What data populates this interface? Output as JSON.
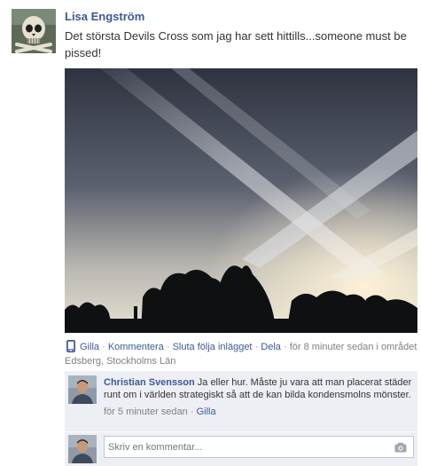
{
  "post": {
    "author": "Lisa Engström",
    "message": "Det största Devils Cross som jag har sett hittills...someone must be pissed!",
    "photo_alt": "Devils Cross"
  },
  "actions": {
    "like": "Gilla",
    "comment": "Kommentera",
    "unfollow": "Sluta följa inlägget",
    "share": "Dela",
    "time_prefix": "för 8 minuter sedan i området",
    "location": "Edsberg, Stockholms Län",
    "separator": "·"
  },
  "comments": [
    {
      "author": "Christian Svensson",
      "text": "Ja eller hur. Måste ju vara att man placerat städer runt om i världen strategiskt så att de kan bilda kondensmolns mönster.",
      "time": "för 5 minuter sedan",
      "like": "Gilla"
    }
  ],
  "composer": {
    "placeholder": "Skriv en kommentar..."
  },
  "colors": {
    "link": "#3b5998",
    "ufi_background": "#edeff4",
    "meta_text": "#808080"
  },
  "icons": {
    "mobile": "mobile-phone-icon",
    "camera": "camera-icon"
  }
}
